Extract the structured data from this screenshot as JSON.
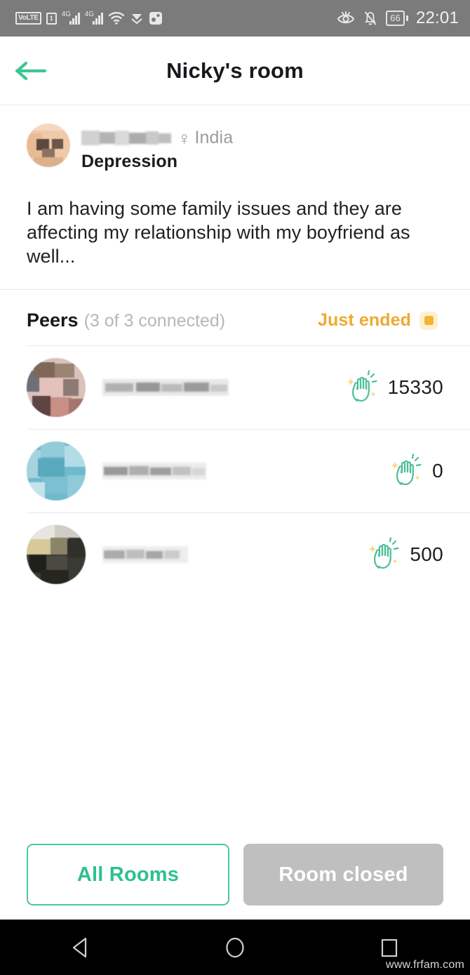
{
  "status_bar": {
    "volte_label": "VoLTE",
    "sim_label": "1",
    "network_1": "4G",
    "network_2": "4G",
    "battery_level": "66",
    "time": "22:01",
    "icons": [
      "volte-badge",
      "sim-1-badge",
      "signal-bars-icon",
      "signal-bars-icon",
      "wifi-icon",
      "app-play-icon",
      "app-dice-icon",
      "eye-comfort-icon",
      "bell-muted-icon",
      "battery-icon"
    ]
  },
  "header": {
    "back_icon": "arrow-left-icon",
    "title": "Nicky's room"
  },
  "post": {
    "author_name_hidden": "",
    "gender_symbol": "♀",
    "country": "India",
    "topic": "Depression",
    "body": "I am having some family issues and they are affecting my relationship with my boyfriend as well..."
  },
  "peers_section": {
    "title": "Peers",
    "count_label": "(3 of 3 connected)",
    "status_label": "Just ended",
    "status_color": "#eeaa2f",
    "peers": [
      {
        "name_hidden": "",
        "claps": "15330",
        "name_width": 180,
        "avatar_style": "skin"
      },
      {
        "name_hidden": "",
        "claps": "0",
        "name_width": 148,
        "avatar_style": "teal"
      },
      {
        "name_hidden": "",
        "claps": "500",
        "name_width": 122,
        "avatar_style": "dark"
      }
    ]
  },
  "footer": {
    "all_rooms_label": "All Rooms",
    "room_closed_label": "Room closed"
  },
  "nav_bar": {
    "back_icon": "nav-back-triangle-icon",
    "home_icon": "nav-home-circle-icon",
    "recents_icon": "nav-recents-square-icon"
  },
  "watermark": "www.frfam.com",
  "colors": {
    "accent_green": "#2ec18d",
    "status_orange": "#eeaa2f",
    "status_bar_bg": "#7b7b7b"
  }
}
